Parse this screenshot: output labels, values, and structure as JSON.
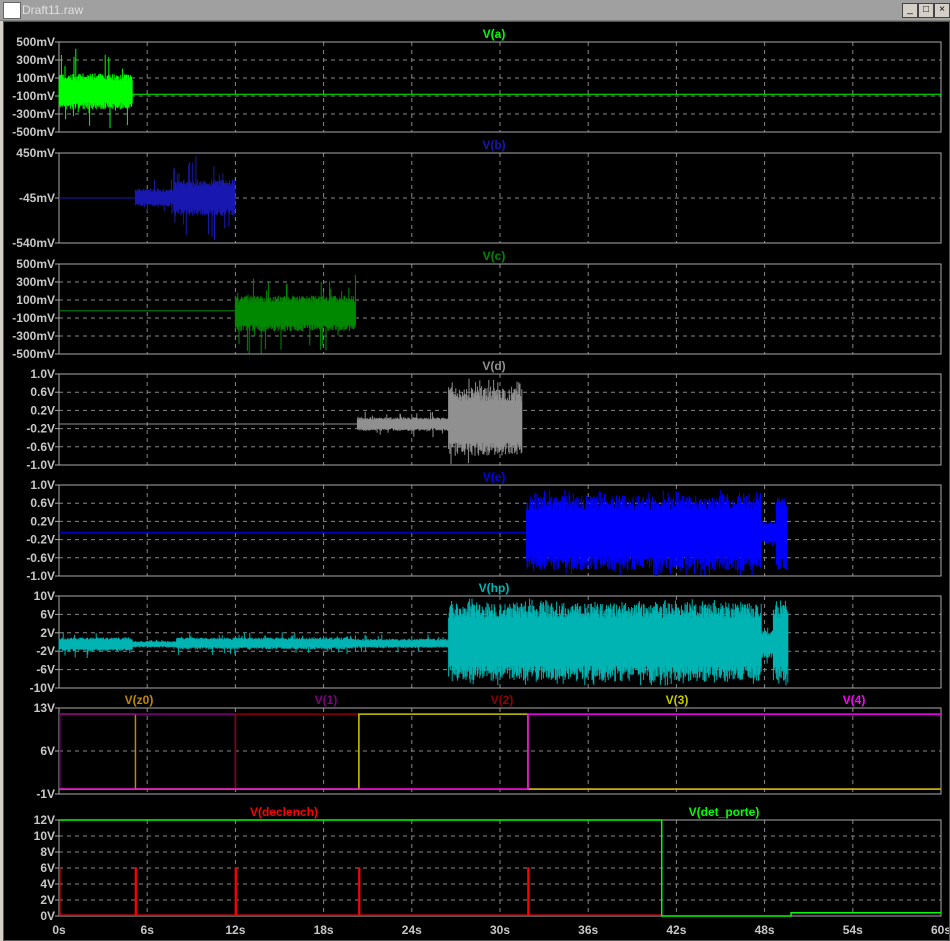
{
  "window": {
    "title": "Draft11.raw",
    "buttons": [
      "_",
      "□",
      "×"
    ]
  },
  "chart_data": {
    "type": "line",
    "xlabel": "time",
    "xlim": [
      0,
      60
    ],
    "xticks": [
      "0s",
      "6s",
      "12s",
      "18s",
      "24s",
      "30s",
      "36s",
      "42s",
      "48s",
      "54s",
      "60s"
    ],
    "panels": [
      {
        "ylim": [
          -0.5,
          0.5
        ],
        "yticks": [
          {
            "v": 0.5,
            "l": "500mV"
          },
          {
            "v": 0.3,
            "l": "300mV"
          },
          {
            "v": 0.1,
            "l": "100mV"
          },
          {
            "v": -0.1,
            "l": "-100mV"
          },
          {
            "v": -0.3,
            "l": "-300mV"
          },
          {
            "v": -0.5,
            "l": "-500mV"
          }
        ],
        "series": [
          {
            "name": "V(a)",
            "color": "#00ff00",
            "base": [
              [
                5,
                60,
                -0.08
              ]
            ],
            "noise": [
              [
                0,
                5,
                -0.05,
                0.2,
                0.5
              ]
            ]
          }
        ]
      },
      {
        "ylim": [
          -0.54,
          0.45
        ],
        "yticks": [
          {
            "v": 0.45,
            "l": "450mV"
          },
          {
            "v": -0.045,
            "l": "-45mV"
          },
          {
            "v": -0.54,
            "l": "-540mV"
          }
        ],
        "series": [
          {
            "name": "V(b)",
            "color": "#1818b0",
            "base": [
              [
                0,
                5.2,
                -0.045
              ]
            ],
            "noise": [
              [
                5.2,
                7.8,
                -0.04,
                0.1,
                0.2
              ],
              [
                7.8,
                12,
                -0.04,
                0.2,
                0.48
              ]
            ]
          }
        ]
      },
      {
        "ylim": [
          -0.5,
          0.5
        ],
        "yticks": [
          {
            "v": 0.5,
            "l": "500mV"
          },
          {
            "v": 0.3,
            "l": "300mV"
          },
          {
            "v": 0.1,
            "l": "100mV"
          },
          {
            "v": -0.1,
            "l": "-100mV"
          },
          {
            "v": -0.3,
            "l": "-300mV"
          },
          {
            "v": -0.5,
            "l": "-500mV"
          }
        ],
        "series": [
          {
            "name": "V(c)",
            "color": "#008800",
            "base": [
              [
                0,
                12,
                -0.02
              ]
            ],
            "noise": [
              [
                12,
                20.2,
                -0.05,
                0.2,
                0.45
              ]
            ]
          }
        ]
      },
      {
        "ylim": [
          -1,
          1
        ],
        "yticks": [
          {
            "v": 1,
            "l": "1.0V"
          },
          {
            "v": 0.6,
            "l": "0.6V"
          },
          {
            "v": 0.2,
            "l": "0.2V"
          },
          {
            "v": -0.2,
            "l": "-0.2V"
          },
          {
            "v": -0.6,
            "l": "-0.6V"
          },
          {
            "v": -1,
            "l": "-1.0V"
          }
        ],
        "series": [
          {
            "name": "V(d)",
            "color": "#909090",
            "base": [
              [
                0,
                20.3,
                -0.1
              ]
            ],
            "noise": [
              [
                20.3,
                26.5,
                -0.1,
                0.15,
                0.3
              ],
              [
                26.5,
                31.5,
                -0.05,
                0.75,
                0.95
              ]
            ]
          }
        ]
      },
      {
        "ylim": [
          -1,
          1
        ],
        "yticks": [
          {
            "v": 1,
            "l": "1.0V"
          },
          {
            "v": 0.6,
            "l": "0.6V"
          },
          {
            "v": 0.2,
            "l": "0.2V"
          },
          {
            "v": -0.2,
            "l": "-0.2V"
          },
          {
            "v": -0.6,
            "l": "-0.6V"
          },
          {
            "v": -1,
            "l": "-1.0V"
          }
        ],
        "series": [
          {
            "name": "V(e)",
            "color": "#0000ff",
            "base": [
              [
                0,
                31.8,
                -0.05
              ]
            ],
            "noise": [
              [
                31.8,
                47.8,
                -0.05,
                0.82,
                0.95
              ],
              [
                47.8,
                48.8,
                -0.05,
                0.25,
                0.35
              ],
              [
                48.8,
                49.5,
                -0.05,
                0.8,
                0.95
              ]
            ]
          }
        ]
      },
      {
        "ylim": [
          -10,
          10
        ],
        "yticks": [
          {
            "v": 10,
            "l": "10V"
          },
          {
            "v": 6,
            "l": "6V"
          },
          {
            "v": 2,
            "l": "2V"
          },
          {
            "v": -2,
            "l": "-2V"
          },
          {
            "v": -6,
            "l": "-6V"
          },
          {
            "v": -10,
            "l": "-10V"
          }
        ],
        "series": [
          {
            "name": "V(hp)",
            "color": "#00b4b4",
            "base": [],
            "noise": [
              [
                0,
                5,
                -0.5,
                1.5,
                3
              ],
              [
                5,
                8,
                -0.5,
                0.7,
                1
              ],
              [
                8,
                20,
                -0.3,
                1.3,
                2.5
              ],
              [
                20,
                26.5,
                -0.3,
                1,
                2
              ],
              [
                26.5,
                47.8,
                0,
                8.5,
                9.5
              ],
              [
                47.8,
                48.6,
                -0.5,
                3,
                4.5
              ],
              [
                48.6,
                49.6,
                0,
                8.5,
                9.5
              ]
            ]
          }
        ]
      },
      {
        "ylim": [
          -1,
          13
        ],
        "yticks": [
          {
            "v": 13,
            "l": "13V"
          },
          {
            "v": 6,
            "l": "6V"
          },
          {
            "v": -1,
            "l": "-1V"
          }
        ],
        "series": [
          {
            "name": "V(z0)",
            "color": "#c08a00",
            "steps": [
              [
                0,
                12
              ],
              [
                5.2,
                -0.2
              ],
              [
                60,
                -0.2
              ]
            ]
          },
          {
            "name": "V(1)",
            "color": "#800080",
            "steps": [
              [
                0,
                -0.2
              ],
              [
                0.05,
                12
              ],
              [
                12,
                -0.2
              ],
              [
                60,
                -0.2
              ]
            ]
          },
          {
            "name": "V(2)",
            "color": "#900000",
            "steps": [
              [
                0,
                -0.2
              ],
              [
                12,
                12
              ],
              [
                20.4,
                -0.2
              ],
              [
                60,
                -0.2
              ]
            ]
          },
          {
            "name": "V(3)",
            "color": "#c8c800",
            "steps": [
              [
                0,
                -0.2
              ],
              [
                20.4,
                12
              ],
              [
                31.9,
                -0.2
              ],
              [
                60,
                -0.2
              ]
            ]
          },
          {
            "name": "V(4)",
            "color": "#ff00ff",
            "steps": [
              [
                0,
                -0.2
              ],
              [
                31.9,
                12
              ],
              [
                60,
                12
              ]
            ]
          }
        ]
      },
      {
        "ylim": [
          0,
          12
        ],
        "yticks": [
          {
            "v": 12,
            "l": "12V"
          },
          {
            "v": 10,
            "l": "10V"
          },
          {
            "v": 8,
            "l": "8V"
          },
          {
            "v": 6,
            "l": "6V"
          },
          {
            "v": 4,
            "l": "4V"
          },
          {
            "v": 2,
            "l": "2V"
          },
          {
            "v": 0,
            "l": "0V"
          }
        ],
        "series": [
          {
            "name": "V(declench)",
            "color": "#ff0000",
            "steps": [
              [
                0,
                6
              ],
              [
                0.05,
                0.1
              ],
              [
                5.2,
                0.1
              ],
              [
                5.2,
                6
              ],
              [
                5.25,
                0.1
              ],
              [
                12,
                0.1
              ],
              [
                12,
                6
              ],
              [
                12.05,
                0.1
              ],
              [
                20.4,
                0.1
              ],
              [
                20.4,
                6
              ],
              [
                20.45,
                0.1
              ],
              [
                31.9,
                0.1
              ],
              [
                31.9,
                6
              ],
              [
                31.95,
                0.1
              ],
              [
                41,
                0.1
              ]
            ]
          },
          {
            "name": "V(det_porte)",
            "color": "#00ff00",
            "steps": [
              [
                0,
                12
              ],
              [
                41,
                12
              ],
              [
                41,
                0
              ],
              [
                49.8,
                0
              ],
              [
                49.8,
                0.4
              ],
              [
                60,
                0.4
              ]
            ]
          }
        ]
      }
    ]
  }
}
